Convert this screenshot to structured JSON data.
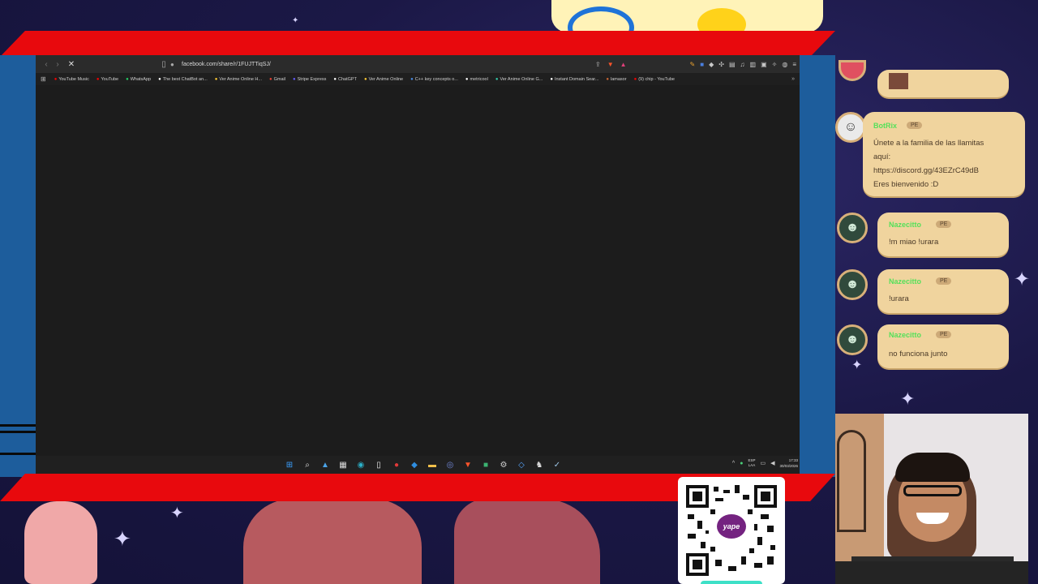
{
  "browser": {
    "url": "facebook.com/share/r/1FUJTTiqSJ/",
    "bookmarks": [
      {
        "label": "YouTube Music",
        "icon": "youtube-music-icon",
        "color": "#ff0000"
      },
      {
        "label": "YouTube",
        "icon": "youtube-icon",
        "color": "#ff0000"
      },
      {
        "label": "WhatsApp",
        "icon": "whatsapp-icon",
        "color": "#25d366"
      },
      {
        "label": "The best ChatBot an...",
        "icon": "chatbot-icon",
        "color": "#ffffff"
      },
      {
        "label": "Ver Anime Online H...",
        "icon": "anime-icon",
        "color": "#ffcc33"
      },
      {
        "label": "Gmail",
        "icon": "gmail-icon",
        "color": "#ea4335"
      },
      {
        "label": "Stripe Express",
        "icon": "stripe-icon",
        "color": "#635bff"
      },
      {
        "label": "ChatGPT",
        "icon": "chatgpt-icon",
        "color": "#ffffff"
      },
      {
        "label": "Ver Anime Online",
        "icon": "anime-icon",
        "color": "#ffcc33"
      },
      {
        "label": "C++ key concepts o...",
        "icon": "cpp-icon",
        "color": "#4a8de6"
      },
      {
        "label": "metricool",
        "icon": "metricool-icon",
        "color": "#ffffff"
      },
      {
        "label": "Ver Anime Online G...",
        "icon": "anime-icon",
        "color": "#33ccaa"
      },
      {
        "label": "Instant Domain Sear...",
        "icon": "domain-search-icon",
        "color": "#ffffff"
      },
      {
        "label": "lamasor",
        "icon": "lamasor-icon",
        "color": "#cc6633"
      },
      {
        "label": "(9) chip - YouTube",
        "icon": "youtube-icon",
        "color": "#ff0000"
      }
    ]
  },
  "taskbar": {
    "icons": [
      {
        "name": "windows-start-icon",
        "glyph": "⊞",
        "color": "#3aa0ff"
      },
      {
        "name": "search-icon",
        "glyph": "⌕",
        "color": "#dddddd"
      },
      {
        "name": "photos-icon",
        "glyph": "▲",
        "color": "#4aa3e8"
      },
      {
        "name": "calculator-icon",
        "glyph": "▦",
        "color": "#dddddd"
      },
      {
        "name": "edge-icon",
        "glyph": "◉",
        "color": "#2bb0c8"
      },
      {
        "name": "file-icon",
        "glyph": "▯",
        "color": "#eeeeee"
      },
      {
        "name": "app-red-icon",
        "glyph": "●",
        "color": "#e03a3a"
      },
      {
        "name": "vscode-icon",
        "glyph": "◆",
        "color": "#2f8ee0"
      },
      {
        "name": "file-explorer-icon",
        "glyph": "▬",
        "color": "#f2c04a"
      },
      {
        "name": "discord-icon",
        "glyph": "◎",
        "color": "#7289da"
      },
      {
        "name": "brave-icon",
        "glyph": "▼",
        "color": "#fb542b"
      },
      {
        "name": "app-green-icon",
        "glyph": "■",
        "color": "#3cb371"
      },
      {
        "name": "settings-icon",
        "glyph": "⚙",
        "color": "#cccccc"
      },
      {
        "name": "app-blue-icon",
        "glyph": "◇",
        "color": "#57a6ff"
      },
      {
        "name": "app-lion-icon",
        "glyph": "♞",
        "color": "#dddddd"
      },
      {
        "name": "steam-icon",
        "glyph": "✓",
        "color": "#9ec8e8"
      }
    ],
    "language_line1": "ESP",
    "language_line2": "LAA",
    "time": "17:33",
    "date": "30/03/2026"
  },
  "chat": {
    "messages": [
      {
        "user": "BotRix",
        "badge": "PE",
        "lines": [
          "Únete a la familia de las llamitas",
          "aquí:",
          "https://discord.gg/43EZrC49dB",
          "Eres bienvenido :D"
        ]
      },
      {
        "user": "Nazecitto",
        "badge": "PE",
        "text": "!m miao !urara"
      },
      {
        "user": "Nazecitto",
        "badge": "PE",
        "text": "!urara"
      },
      {
        "user": "Nazecitto",
        "badge": "PE",
        "text": "no funciona junto"
      }
    ]
  },
  "qr": {
    "brand": "yape"
  }
}
